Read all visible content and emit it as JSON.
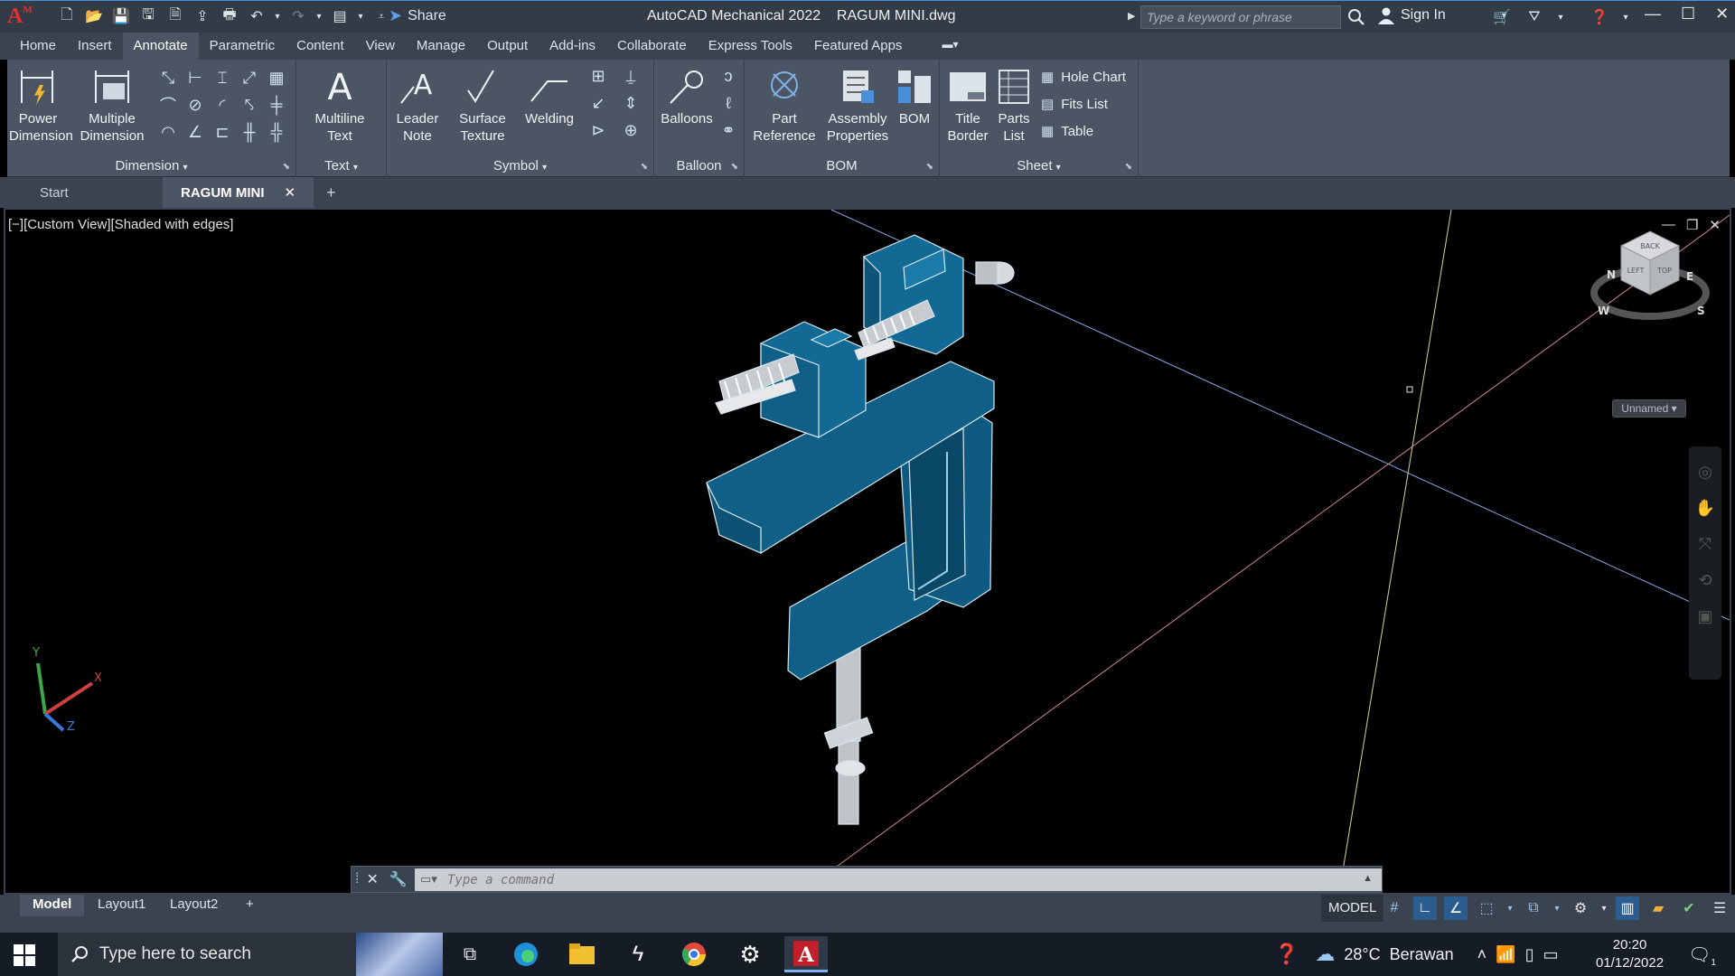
{
  "titlebar": {
    "logo_letter": "A",
    "logo_sub": "M",
    "share_label": "Share",
    "app_title": "AutoCAD Mechanical 2022",
    "file_name": "RAGUM MINI.dwg",
    "search_placeholder": "Type a keyword or phrase",
    "signin_label": "Sign In"
  },
  "ribbon_tabs": [
    "Home",
    "Insert",
    "Annotate",
    "Parametric",
    "Content",
    "View",
    "Manage",
    "Output",
    "Add-ins",
    "Collaborate",
    "Express Tools",
    "Featured Apps"
  ],
  "ribbon": {
    "dimension": {
      "panel_label": "Dimension",
      "power_dimension": [
        "Power",
        "Dimension"
      ],
      "multiple_dimension": [
        "Multiple",
        "Dimension"
      ]
    },
    "text": {
      "panel_label": "Text",
      "multiline_text": [
        "Multiline",
        "Text"
      ]
    },
    "symbol": {
      "panel_label": "Symbol",
      "leader_note": [
        "Leader",
        "Note"
      ],
      "surface_texture": [
        "Surface",
        "Texture"
      ],
      "welding": "Welding"
    },
    "balloon": {
      "panel_label": "Balloon",
      "balloons": "Balloons"
    },
    "bom": {
      "panel_label": "BOM",
      "part_reference": [
        "Part",
        "Reference"
      ],
      "assembly_properties": [
        "Assembly",
        "Properties"
      ],
      "bom": "BOM"
    },
    "sheet": {
      "panel_label": "Sheet",
      "title_border": [
        "Title",
        "Border"
      ],
      "parts_list": [
        "Parts",
        "List"
      ],
      "hole_chart": "Hole Chart",
      "fits_list": "Fits List",
      "table": "Table"
    }
  },
  "doc_tabs": {
    "start": "Start",
    "active": "RAGUM MINI",
    "close": "✕",
    "add": "+"
  },
  "viewport": {
    "label": "[−][Custom View][Shaded with edges]",
    "viewcube_labels": [
      "TOP",
      "LEFT",
      "BACK"
    ],
    "compass": [
      "N",
      "E",
      "S",
      "W"
    ],
    "view_name": "Unnamed",
    "ucs_labels": [
      "Y",
      "X",
      "Z"
    ]
  },
  "command": {
    "placeholder": "Type a command"
  },
  "layout_tabs": [
    "Model",
    "Layout1",
    "Layout2"
  ],
  "status": {
    "model_label": "MODEL"
  },
  "taskbar": {
    "search_placeholder": "Type here to search",
    "weather": "28°C  Berawan",
    "time": "20:20",
    "date": "01/12/2022",
    "notif_count": "1"
  },
  "colors": {
    "accent": "#4a90d9",
    "model_blue": "#0f5f86",
    "ribbon_bg": "#4b5564"
  }
}
